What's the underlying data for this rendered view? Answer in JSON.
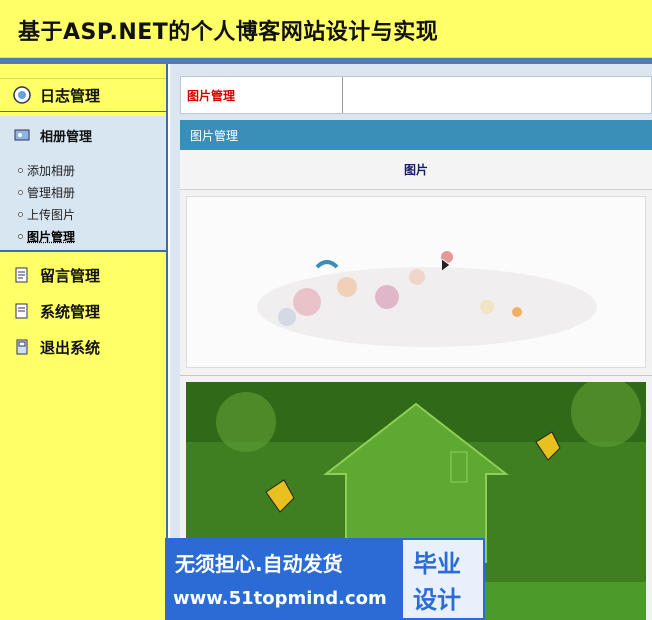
{
  "header": {
    "title": "基于ASP.NET的个人博客网站设计与实现"
  },
  "sidebar": {
    "diary": "日志管理",
    "album": {
      "label": "相册管理",
      "items": [
        "添加相册",
        "管理相册",
        "上传图片",
        "图片管理"
      ]
    },
    "messages": "留言管理",
    "system": "系统管理",
    "exit": "退出系统"
  },
  "content": {
    "tab_label": "图片管理",
    "panel_title": "图片管理",
    "column_header": "图片"
  },
  "watermark": {
    "line1": "无须担心.自动发货",
    "line2": "www.51topmind.com",
    "badge1": "毕业",
    "badge2": "设计"
  },
  "colors": {
    "header_bg": "#ffff66",
    "accent_blue": "#3a8fb8",
    "tab_red": "#d40000"
  }
}
